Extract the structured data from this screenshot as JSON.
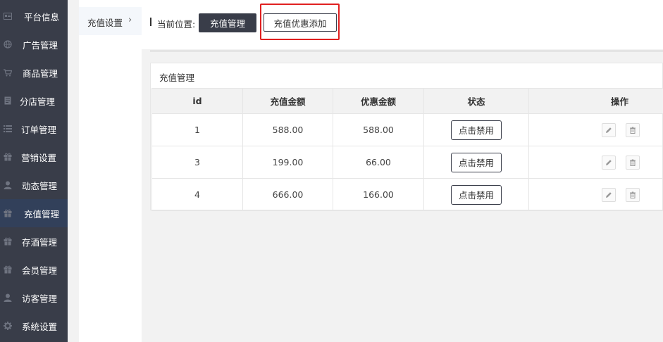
{
  "sidebar": {
    "items": [
      {
        "label": "平台信息",
        "icon": "id-card-icon"
      },
      {
        "label": "广告管理",
        "icon": "globe-icon"
      },
      {
        "label": "商品管理",
        "icon": "cart-icon"
      },
      {
        "label": "分店管理",
        "icon": "document-icon"
      },
      {
        "label": "订单管理",
        "icon": "list-icon"
      },
      {
        "label": "营销设置",
        "icon": "gift-icon"
      },
      {
        "label": "动态管理",
        "icon": "user-icon"
      },
      {
        "label": "充值管理",
        "icon": "gift-icon"
      },
      {
        "label": "存酒管理",
        "icon": "gift-icon"
      },
      {
        "label": "会员管理",
        "icon": "gift-icon"
      },
      {
        "label": "访客管理",
        "icon": "user-icon"
      },
      {
        "label": "系统设置",
        "icon": "gear-icon"
      }
    ],
    "active_index": 7
  },
  "subnav": {
    "item_label": "充值设置",
    "chevron": "›"
  },
  "topbar": {
    "location_label": "当前位置:",
    "current_button": "充值管理",
    "add_button": "充值优惠添加"
  },
  "panel": {
    "title": "充值管理",
    "columns": [
      "id",
      "充值金额",
      "优惠金额",
      "状态",
      "操作"
    ],
    "rows": [
      {
        "id": "1",
        "amount": "588.00",
        "discount": "588.00",
        "status_button": "点击禁用"
      },
      {
        "id": "3",
        "amount": "199.00",
        "discount": "66.00",
        "status_button": "点击禁用"
      },
      {
        "id": "4",
        "amount": "666.00",
        "discount": "166.00",
        "status_button": "点击禁用"
      }
    ]
  },
  "colors": {
    "sidebar_bg": "#393d49",
    "sidebar_active": "#32405a",
    "dark_button": "#393d49",
    "highlight_box": "#e02020"
  }
}
